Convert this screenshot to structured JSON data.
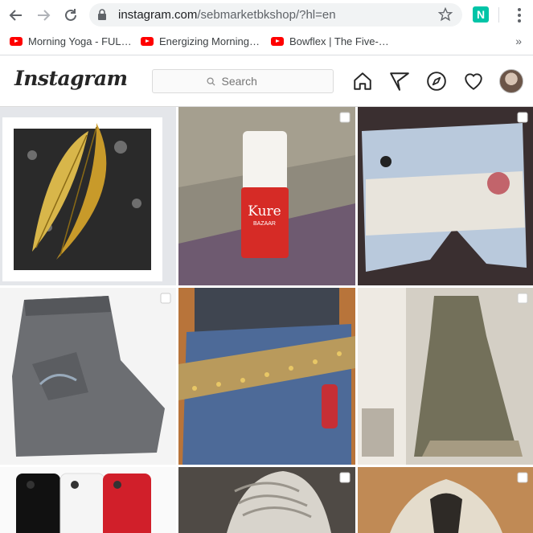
{
  "browser": {
    "url_host": "instagram.com",
    "url_path": "/sebmarketbkshop/?hl=en",
    "extension_label": "N"
  },
  "bookmarks": [
    {
      "label": "Morning Yoga - FUL…"
    },
    {
      "label": "Energizing Morning…"
    },
    {
      "label": "Bowflex | The Five-…"
    }
  ],
  "bookmarks_more": "»",
  "instagram": {
    "logo": "Instagram",
    "search_placeholder": "Search"
  },
  "grid": {
    "posts": [
      {
        "subject": "gold feather brooch",
        "multi": false
      },
      {
        "subject": "red Kure Bazaar nail polish",
        "multi": true
      },
      {
        "subject": "distressed denim shorts",
        "multi": true
      },
      {
        "subject": "grey folded jeans",
        "multi": true
      },
      {
        "subject": "studded belt on jeans",
        "multi": false
      },
      {
        "subject": "olive sundress on mannequin",
        "multi": true
      },
      {
        "subject": "smartphones",
        "multi": false
      },
      {
        "subject": "sneaker laces",
        "multi": true
      },
      {
        "subject": "beige hoodie",
        "multi": true
      }
    ],
    "polish_brand": "Kure",
    "polish_sub": "BAZAAR"
  },
  "colors": {
    "accent": "#262626",
    "youtube": "#ff0000",
    "extension": "#00c4a7"
  }
}
